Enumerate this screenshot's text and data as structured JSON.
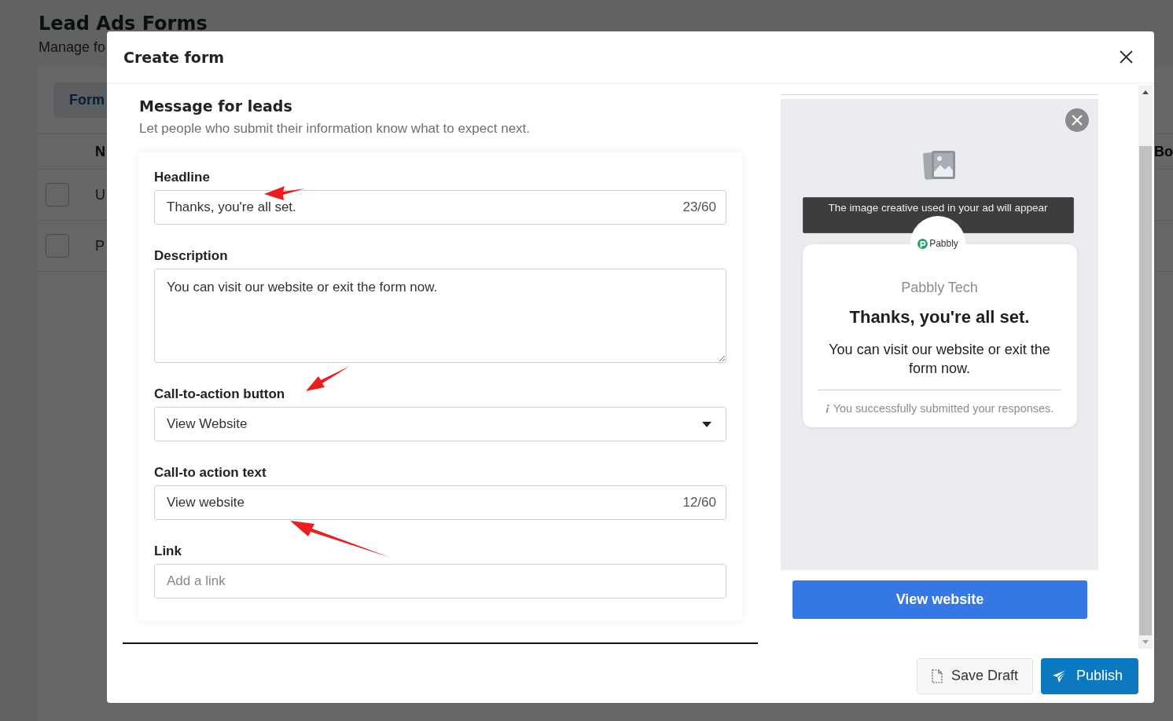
{
  "page": {
    "title": "Lead Ads Forms",
    "subtitle": "Manage fo",
    "tab": "Form",
    "columns": [
      "N",
      "Bo"
    ],
    "rows": [
      {
        "cell": "U",
        "checked": false
      },
      {
        "cell": "P",
        "checked": false
      }
    ]
  },
  "modal": {
    "title": "Create form"
  },
  "section": {
    "title": "Message for leads",
    "subtitle": "Let people who submit their information know what to expect next."
  },
  "fields": [
    {
      "kind": "text",
      "label": "Headline",
      "value": "Thanks, you're all set.",
      "counter": "23/60"
    },
    {
      "kind": "textarea",
      "label": "Description",
      "value": "You can visit our website or exit the form now."
    },
    {
      "kind": "select",
      "label": "Call-to-action button",
      "value": "View Website"
    },
    {
      "kind": "text",
      "label": "Call-to action text",
      "value": "View website",
      "counter": "12/60"
    },
    {
      "kind": "text",
      "label": "Link",
      "placeholder": "Add a link"
    }
  ],
  "preview": {
    "banner": "The image creative used in your ad will appear",
    "logo": "Pabbly",
    "company": "Pabbly Tech",
    "headline": "Thanks, you're all set.",
    "description": "You can visit our website or exit the form now.",
    "note": "You successfully submitted your responses.",
    "button": "View website"
  },
  "footer": {
    "buttons": [
      {
        "kind": "secondary",
        "label": "Save Draft"
      },
      {
        "kind": "primary",
        "label": "Publish"
      }
    ]
  }
}
